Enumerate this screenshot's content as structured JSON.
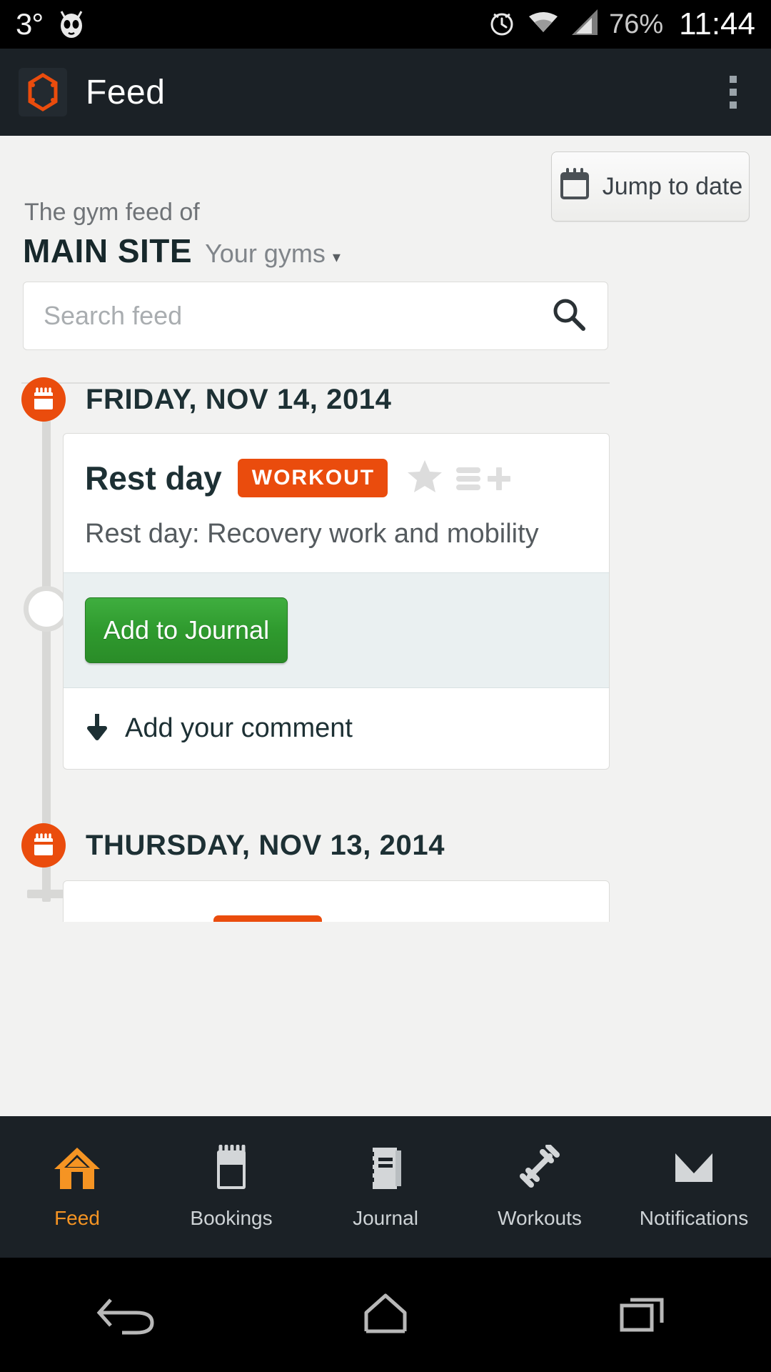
{
  "status_bar": {
    "temperature": "3°",
    "os_icon": "cyanogenmod-skull-icon",
    "alarm_icon": "alarm-icon",
    "wifi_icon": "wifi-icon",
    "signal_icon": "cellular-signal-icon",
    "battery": "76%",
    "clock": "11:44"
  },
  "app_bar": {
    "logo_icon": "app-logo-icon",
    "title": "Feed",
    "overflow_icon": "overflow-menu-icon"
  },
  "header": {
    "feed_of_label": "The gym feed of",
    "site_name": "MAIN SITE",
    "gyms_selector": "Your gyms",
    "gyms_caret": "▾",
    "jump_to_date_label": "Jump to date",
    "jump_to_date_icon": "calendar-icon"
  },
  "search": {
    "placeholder": "Search feed",
    "value": "",
    "icon": "search-icon"
  },
  "feed": {
    "days": [
      {
        "date_label": "FRIDAY, NOV 14, 2014",
        "date_icon": "calendar-badge-icon",
        "card": {
          "title": "Rest day",
          "badge": "WORKOUT",
          "star_icon": "star-icon",
          "add_to_list_icon": "list-plus-icon",
          "description": "Rest day: Recovery work and mobility",
          "primary_action": "Add to Journal",
          "comment_action": "Add your comment",
          "comment_icon": "arrow-down-icon"
        }
      },
      {
        "date_label": "THURSDAY, NOV 13, 2014",
        "date_icon": "calendar-badge-icon"
      }
    ]
  },
  "bottom_nav": {
    "items": [
      {
        "label": "Feed",
        "icon": "home-icon",
        "active": true
      },
      {
        "label": "Bookings",
        "icon": "calendar-icon",
        "active": false
      },
      {
        "label": "Journal",
        "icon": "book-icon",
        "active": false
      },
      {
        "label": "Workouts",
        "icon": "dumbbell-icon",
        "active": false
      },
      {
        "label": "Notifications",
        "icon": "envelope-icon",
        "active": false
      }
    ]
  },
  "system_nav": {
    "back_icon": "back-arrow-icon",
    "home_icon": "home-outline-icon",
    "recents_icon": "recent-apps-icon"
  },
  "colors": {
    "accent_orange": "#ea4c0d",
    "tab_active": "#f59423",
    "dark_teal": "#1d3034",
    "green_button": "#2f9a2e",
    "appbar_dark": "#1b2126",
    "page_bg": "#f2f2f1"
  }
}
